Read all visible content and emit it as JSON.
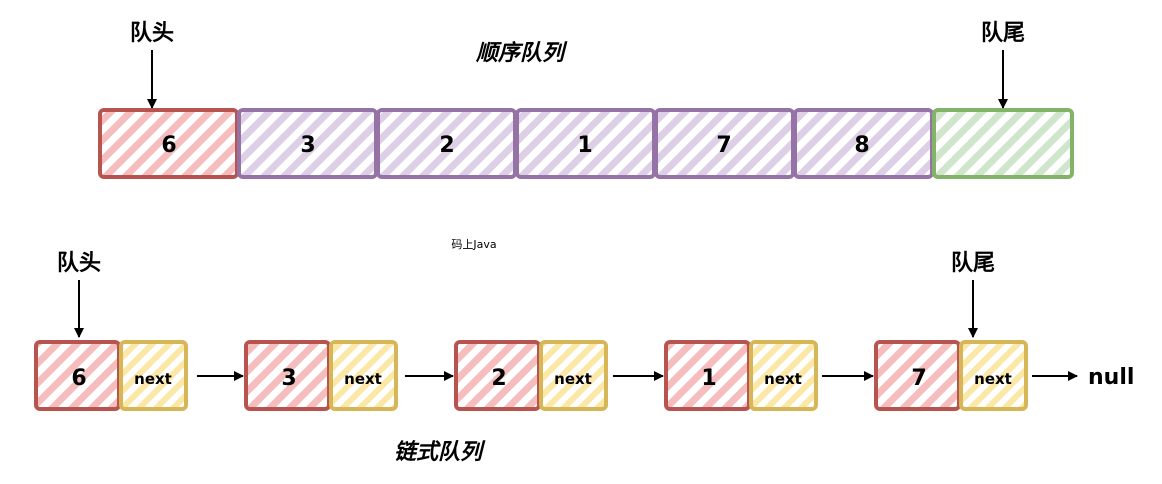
{
  "sequential_queue": {
    "title": "顺序队列",
    "head_label": "队头",
    "tail_label": "队尾",
    "cells": [
      "6",
      "3",
      "2",
      "1",
      "7",
      "8",
      ""
    ]
  },
  "linked_queue": {
    "title": "链式队列",
    "head_label": "队头",
    "tail_label": "队尾",
    "nodes": [
      {
        "value": "6",
        "next": "next"
      },
      {
        "value": "3",
        "next": "next"
      },
      {
        "value": "2",
        "next": "next"
      },
      {
        "value": "1",
        "next": "next"
      },
      {
        "value": "7",
        "next": "next"
      }
    ],
    "terminal": "null"
  },
  "watermark": "码上Java",
  "colors": {
    "head_fill": "#f8c7c7",
    "head_stroke": "#b85450",
    "mid_fill": "#e1d5e7",
    "mid_stroke": "#9673a6",
    "tail_fill": "#d5e8d4",
    "tail_stroke": "#82b366",
    "next_fill": "#fff2cc",
    "next_stroke": "#d6b656"
  }
}
